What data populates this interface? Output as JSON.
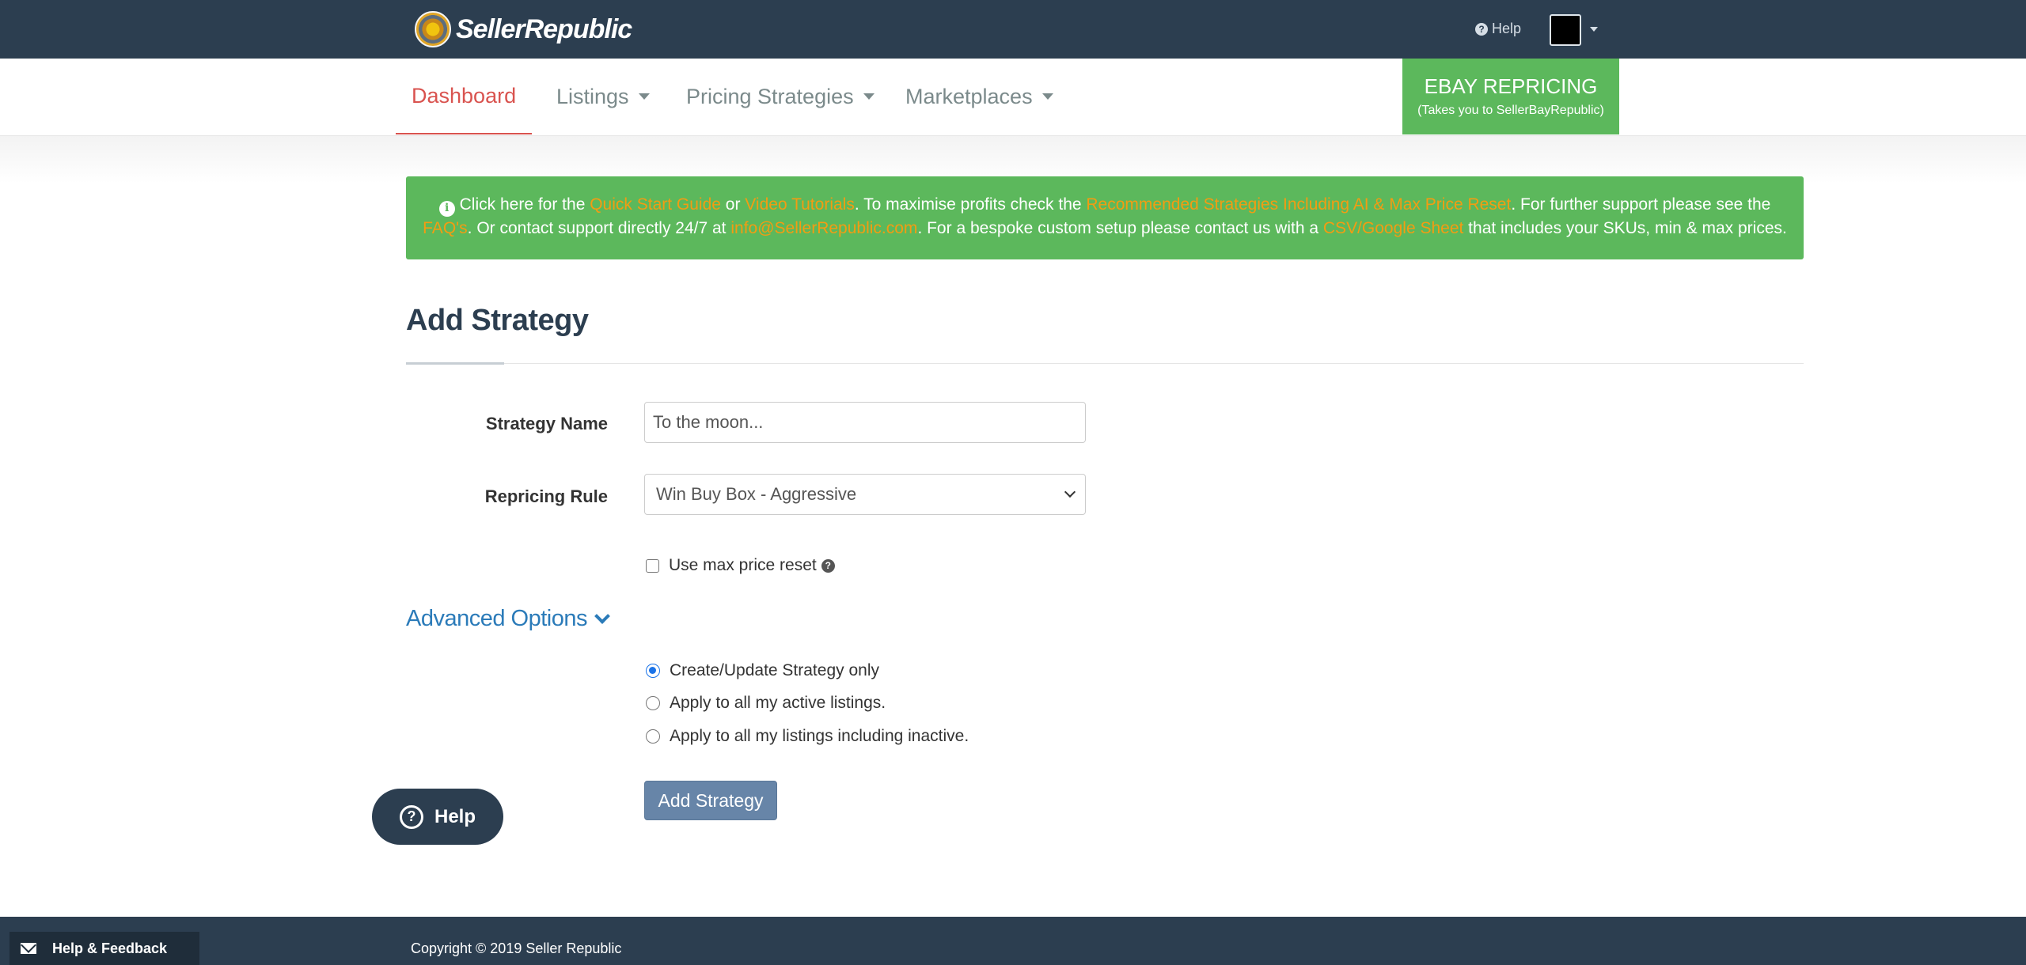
{
  "header": {
    "brand": "SellerRepublic",
    "help_label": "Help"
  },
  "nav": {
    "items": [
      {
        "label": "Dashboard"
      },
      {
        "label": "Listings"
      },
      {
        "label": "Pricing Strategies"
      },
      {
        "label": "Marketplaces"
      }
    ],
    "ebay_title": "EBAY REPRICING",
    "ebay_subtitle": "(Takes you to SellerBayRepublic)"
  },
  "alert": {
    "t1": "Click here for the ",
    "link_quick_start": "Quick Start Guide",
    "t2": " or ",
    "link_video": "Video Tutorials",
    "t3": ". To maximise profits check the ",
    "link_recommended": "Recommended Strategies Including AI & Max Price Reset",
    "t4": ". For further support please see the ",
    "link_faq": "FAQ's",
    "t5": ". Or contact support directly 24/7 at ",
    "link_email": "info@SellerRepublic.com",
    "t6": ". For a bespoke custom setup please contact us with a ",
    "link_csv": "CSV/Google Sheet",
    "t7": " that includes your SKUs, min & max prices."
  },
  "form": {
    "title": "Add Strategy",
    "strategy_name_label": "Strategy Name",
    "strategy_name_placeholder": "To the moon...",
    "repricing_rule_label": "Repricing Rule",
    "repricing_rule_value": "Win Buy Box - Aggressive",
    "max_price_reset_label": "Use max price reset",
    "advanced_label": "Advanced Options",
    "radio_options": [
      {
        "label": "Create/Update Strategy only"
      },
      {
        "label": "Apply to all my active listings."
      },
      {
        "label": "Apply to all my listings including inactive."
      }
    ],
    "submit_label": "Add Strategy"
  },
  "help_widget_label": "Help",
  "footer": {
    "copyright": "Copyright © 2019 Seller Republic",
    "feedback_label": "Help & Feedback"
  },
  "colors": {
    "topbar": "#2c3e50",
    "active_nav": "#d9534f",
    "success": "#5cb85c",
    "alert_link": "#f39c12",
    "primary_button": "#6785a8",
    "link": "#2b7bb9"
  }
}
